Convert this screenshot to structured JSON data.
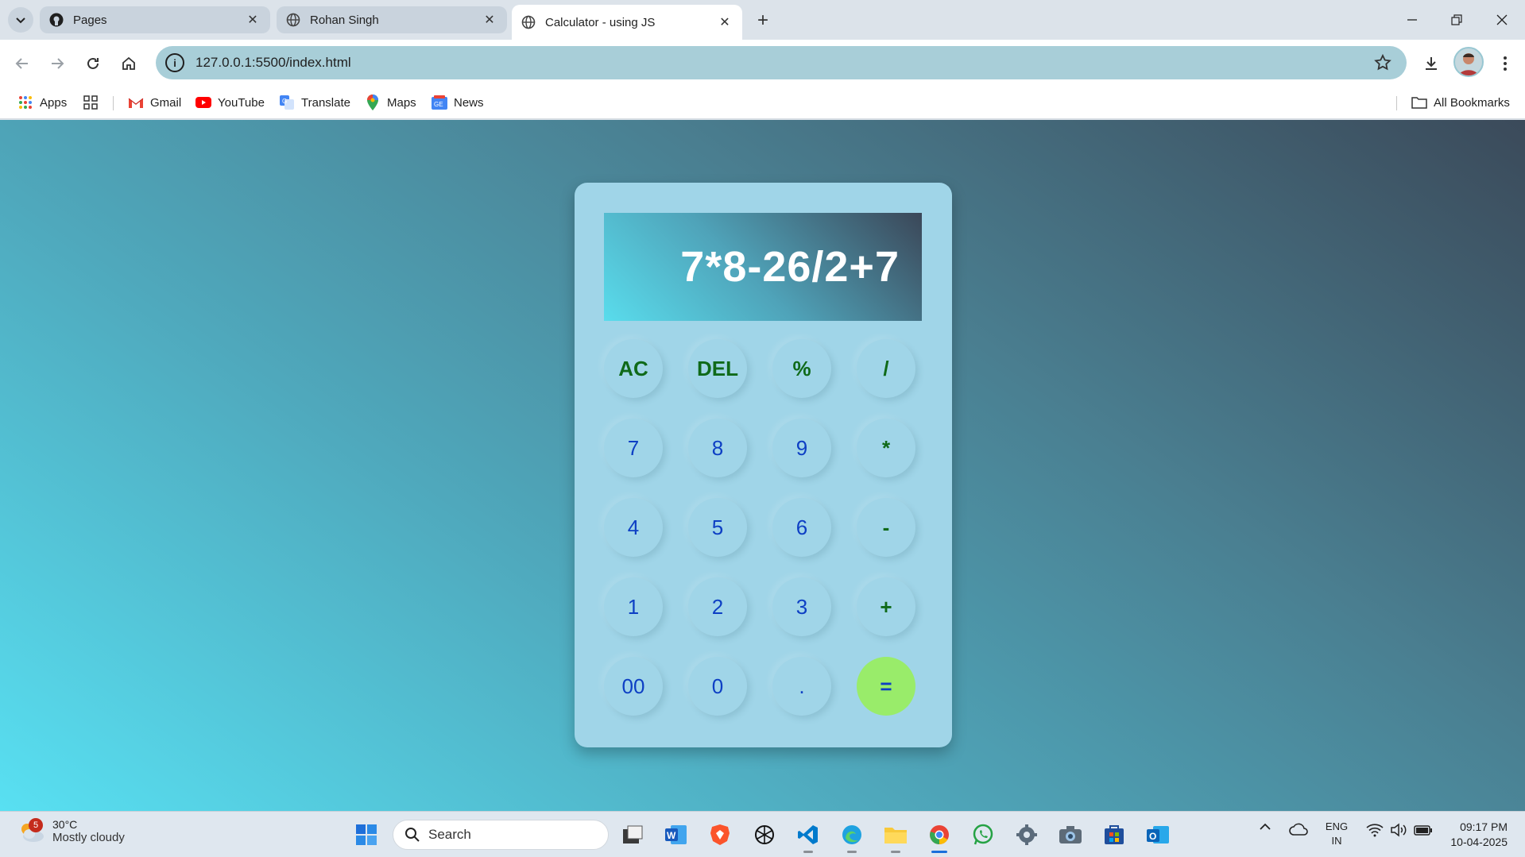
{
  "browser": {
    "tabs": [
      {
        "label": "Pages",
        "icon": "github-icon",
        "active": false
      },
      {
        "label": "Rohan Singh",
        "icon": "globe-icon",
        "active": false
      },
      {
        "label": "Calculator - using JS",
        "icon": "globe-icon",
        "active": true
      }
    ],
    "address": "127.0.0.1:5500/index.html",
    "bookmarks": [
      {
        "label": "Apps",
        "icon": "apps-grid-icon"
      },
      {
        "label": "Gmail",
        "icon": "gmail-icon"
      },
      {
        "label": "YouTube",
        "icon": "youtube-icon"
      },
      {
        "label": "Translate",
        "icon": "translate-icon"
      },
      {
        "label": "Maps",
        "icon": "maps-pin-icon"
      },
      {
        "label": "News",
        "icon": "news-icon"
      }
    ],
    "all_bookmarks": "All Bookmarks"
  },
  "calculator": {
    "display": "7*8-26/2+7",
    "keys": [
      [
        "AC",
        "DEL",
        "%",
        "/"
      ],
      [
        "7",
        "8",
        "9",
        "*"
      ],
      [
        "4",
        "5",
        "6",
        "-"
      ],
      [
        "1",
        "2",
        "3",
        "+"
      ],
      [
        "00",
        "0",
        ".",
        "="
      ]
    ],
    "colors": {
      "operator_text": "#0f6a19",
      "number_text": "#0d3fc4",
      "equals_bg": "#99ec6a",
      "body_bg": "#a0d5e8"
    }
  },
  "taskbar": {
    "weather_temp": "30°C",
    "weather_desc": "Mostly cloudy",
    "weather_badge": "5",
    "search_placeholder": "Search",
    "lang_top": "ENG",
    "lang_bottom": "IN",
    "time": "09:17 PM",
    "date": "10-04-2025",
    "apps": [
      "start-icon",
      "file-explorer-dark-icon",
      "word-icon",
      "brave-icon",
      "chatgpt-icon",
      "vscode-icon",
      "edge-icon",
      "file-explorer-icon",
      "chrome-icon",
      "whatsapp-icon",
      "settings-icon",
      "camera-icon",
      "store-icon",
      "outlook-icon"
    ]
  }
}
